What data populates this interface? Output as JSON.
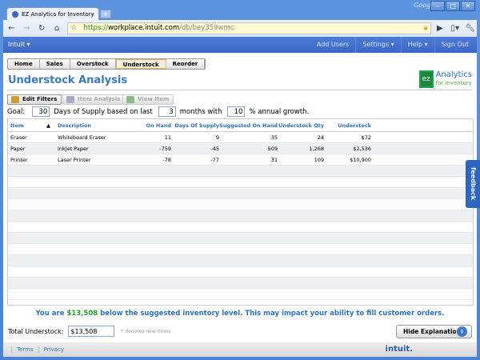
{
  "browser": {
    "tab_title": "EZ Analytics for Inventory ...",
    "google_label": "Google",
    "url_scheme": "https://",
    "url_host": "workplace.intuit.com",
    "url_path": "/db/bey359wmc"
  },
  "intuit_bar": {
    "brand": "Intuit ▾",
    "links": [
      "Add Users",
      "Settings ▾",
      "Help ▾",
      "Sign Out"
    ]
  },
  "nav_tabs": [
    "Home",
    "Sales",
    "Overstock",
    "Understock",
    "Reorder"
  ],
  "page_title": "Understock Analysis",
  "logo": {
    "main": "Analytics",
    "sub": "for inventory",
    "mark": "ez"
  },
  "actions": {
    "edit_filters": "Edit Filters",
    "item_analysis": "Item Analysis",
    "view_item": "View Item"
  },
  "goal": {
    "label": "Goal:",
    "days": "30",
    "days_text": "Days of Supply based on last",
    "months": "3",
    "months_text": "months with",
    "growth": "10",
    "growth_text": "% annual growth."
  },
  "table": {
    "columns": [
      "Item",
      "Description",
      "On Hand",
      "Days Of Supply",
      "Suggested On Hand",
      "Understock Qty",
      "Understock"
    ],
    "sort_indicator": "▲",
    "rows": [
      [
        "Eraser",
        "Whiteboard Eraser",
        "11",
        "9",
        "35",
        "24",
        "$72"
      ],
      [
        "Paper",
        "Inkjet Paper",
        "-759",
        "-45",
        "509",
        "1,268",
        "$2,536"
      ],
      [
        "Printer",
        "Laser Printer",
        "-78",
        "-77",
        "31",
        "109",
        "$10,900"
      ]
    ]
  },
  "feedback": "feedback",
  "message": {
    "pre": "You are ",
    "amount": "$13,508",
    "post": " below the suggested inventory level. This may impact your ability to fill customer orders."
  },
  "total": {
    "label": "Total Understock:",
    "value": "$13,508",
    "note": "* denotes new items"
  },
  "hide_explanation": "Hide Explanation",
  "footer": {
    "terms": "Terms",
    "privacy": "Privacy",
    "brand": "intuit."
  }
}
